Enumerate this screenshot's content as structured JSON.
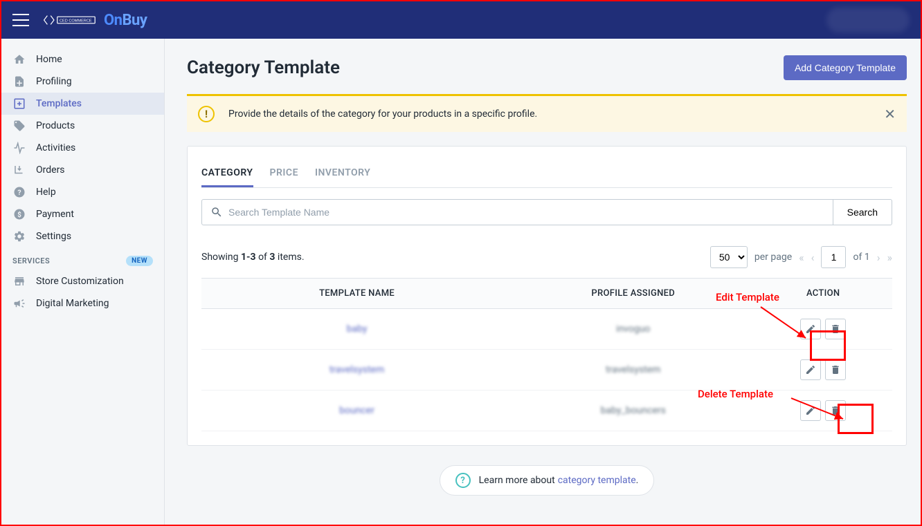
{
  "header": {
    "brand_on": "On",
    "brand_buy": "Buy"
  },
  "sidebar": {
    "items": [
      {
        "label": "Home"
      },
      {
        "label": "Profiling"
      },
      {
        "label": "Templates"
      },
      {
        "label": "Products"
      },
      {
        "label": "Activities"
      },
      {
        "label": "Orders"
      },
      {
        "label": "Help"
      },
      {
        "label": "Payment"
      },
      {
        "label": "Settings"
      }
    ],
    "services_label": "SERVICES",
    "new_badge": "NEW",
    "services": [
      {
        "label": "Store Customization"
      },
      {
        "label": "Digital Marketing"
      }
    ]
  },
  "page": {
    "title": "Category Template",
    "add_button": "Add Category Template",
    "alert": "Provide the details of the category for your products in a specific profile.",
    "tabs": [
      {
        "label": "CATEGORY",
        "active": true
      },
      {
        "label": "PRICE"
      },
      {
        "label": "INVENTORY"
      }
    ],
    "search": {
      "placeholder": "Search Template Name",
      "button": "Search"
    },
    "count": {
      "prefix": "Showing ",
      "range": "1-3",
      "mid": " of ",
      "total": "3",
      "suffix": " items."
    },
    "pager": {
      "per_page": "50",
      "per_page_label": "per page",
      "page": "1",
      "of_label": "of 1"
    },
    "columns": {
      "name": "TEMPLATE NAME",
      "profile": "PROFILE ASSIGNED",
      "action": "ACTION"
    },
    "rows": [
      {
        "name": "baby",
        "profile": "invoguo"
      },
      {
        "name": "travelsystem",
        "profile": "travelsystem"
      },
      {
        "name": "bouncer",
        "profile": "baby_bouncers"
      }
    ],
    "learn": {
      "prefix": "Learn more about ",
      "link": "category template",
      "suffix": "."
    }
  },
  "annotations": {
    "edit": "Edit Template",
    "delete": "Delete Template"
  }
}
